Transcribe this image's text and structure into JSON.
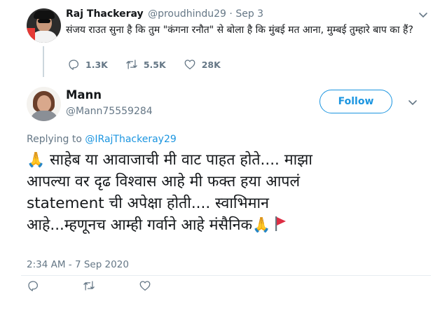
{
  "parent_tweet": {
    "author_name": "Raj Thackeray",
    "handle": "@proudhindu29",
    "separator": "·",
    "date": "Sep 3",
    "text": "संजय राउत सुना है कि तुम \"कंगना रनौत\" से बोला है कि मुंबई मत आना, मुम्बई तुम्हारे बाप का हैं?",
    "actions": {
      "reply_count": "1.3K",
      "retweet_count": "5.5K",
      "like_count": "28K"
    }
  },
  "main_tweet": {
    "author_name": "Mann",
    "handle": "@Mann75559284",
    "follow_label": "Follow",
    "replying_to_label": "Replying to",
    "replying_to_handle": "@IRajThackeray29",
    "text_lines": [
      "साहेब या आवाजाची मी वाट पाहत होते.... माझा",
      "आपल्या वर दृढ विश्वास आहे मी फक्त हया आपलं",
      "statement ची अपेक्षा होती.... स्वाभिमान",
      "आहे...म्हणूनच आम्ही गर्वाने आहे मंसैनिक"
    ],
    "timestamp": "2:34 AM - 7 Sep 2020"
  },
  "icons": {
    "reply": "reply-icon",
    "retweet": "retweet-icon",
    "like": "heart-icon",
    "more": "chevron-down-icon",
    "emoji_pray": "folded-hands-emoji",
    "emoji_flag": "red-flag-emoji"
  },
  "colors": {
    "accent": "#1b95e0",
    "secondary_text": "#657786",
    "thread_line": "#ccd6dd",
    "flag": "#dd2e44"
  }
}
